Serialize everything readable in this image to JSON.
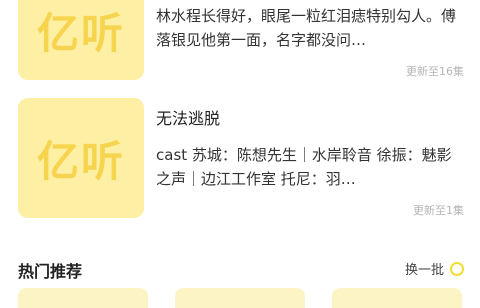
{
  "books": [
    {
      "cover_text": "亿听",
      "title": "",
      "description": "林水程长得好，眼尾一粒红泪痣特别勾人。傅落银见他第一面，名字都没问…",
      "update": "更新至16集"
    },
    {
      "cover_text": "亿听",
      "title": "无法逃脱",
      "description": "cast 苏城：陈想先生｜水岸聆音 徐振：魅影之声｜边江工作室 托尼：羽…",
      "update": "更新至1集"
    }
  ],
  "section": {
    "title": "热门推荐",
    "refresh_label": "换一批"
  },
  "colors": {
    "cover_bg": "#fdefa3",
    "cover_logo": "#f7d44e",
    "accent": "#f0de30"
  }
}
